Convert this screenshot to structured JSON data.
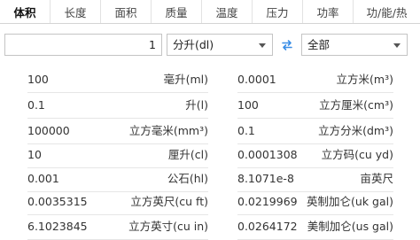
{
  "tabs": [
    {
      "label": "体积",
      "active": true
    },
    {
      "label": "长度",
      "active": false
    },
    {
      "label": "面积",
      "active": false
    },
    {
      "label": "质量",
      "active": false
    },
    {
      "label": "温度",
      "active": false
    },
    {
      "label": "压力",
      "active": false
    },
    {
      "label": "功率",
      "active": false
    },
    {
      "label": "功/能/热",
      "active": false
    }
  ],
  "converter": {
    "input_value": "1",
    "from_unit": "分升(dl)",
    "to_unit": "全部"
  },
  "results": [
    {
      "left_value": "100",
      "left_unit": "毫升(ml)",
      "right_value": "0.0001",
      "right_unit": "立方米(m³)"
    },
    {
      "left_value": "0.1",
      "left_unit": "升(l)",
      "right_value": "100",
      "right_unit": "立方厘米(cm³)"
    },
    {
      "left_value": "100000",
      "left_unit": "立方毫米(mm³)",
      "right_value": "0.1",
      "right_unit": "立方分米(dm³)"
    },
    {
      "left_value": "10",
      "left_unit": "厘升(cl)",
      "right_value": "0.0001308",
      "right_unit": "立方码(cu yd)"
    },
    {
      "left_value": "0.001",
      "left_unit": "公石(hl)",
      "right_value": "8.1071e-8",
      "right_unit": "亩英尺"
    },
    {
      "left_value": "0.0035315",
      "left_unit": "立方英尺(cu ft)",
      "right_value": "0.0219969",
      "right_unit": "英制加仑(uk gal)"
    },
    {
      "left_value": "6.1023845",
      "left_unit": "立方英寸(cu in)",
      "right_value": "0.0264172",
      "right_unit": "美制加仑(us gal)"
    }
  ],
  "colors": {
    "swap_icon": "#3a8ee6",
    "divider": "#e6e6e6"
  },
  "icons": {
    "swap": "swap-arrows-icon",
    "dropdown": "chevron-down-icon"
  }
}
